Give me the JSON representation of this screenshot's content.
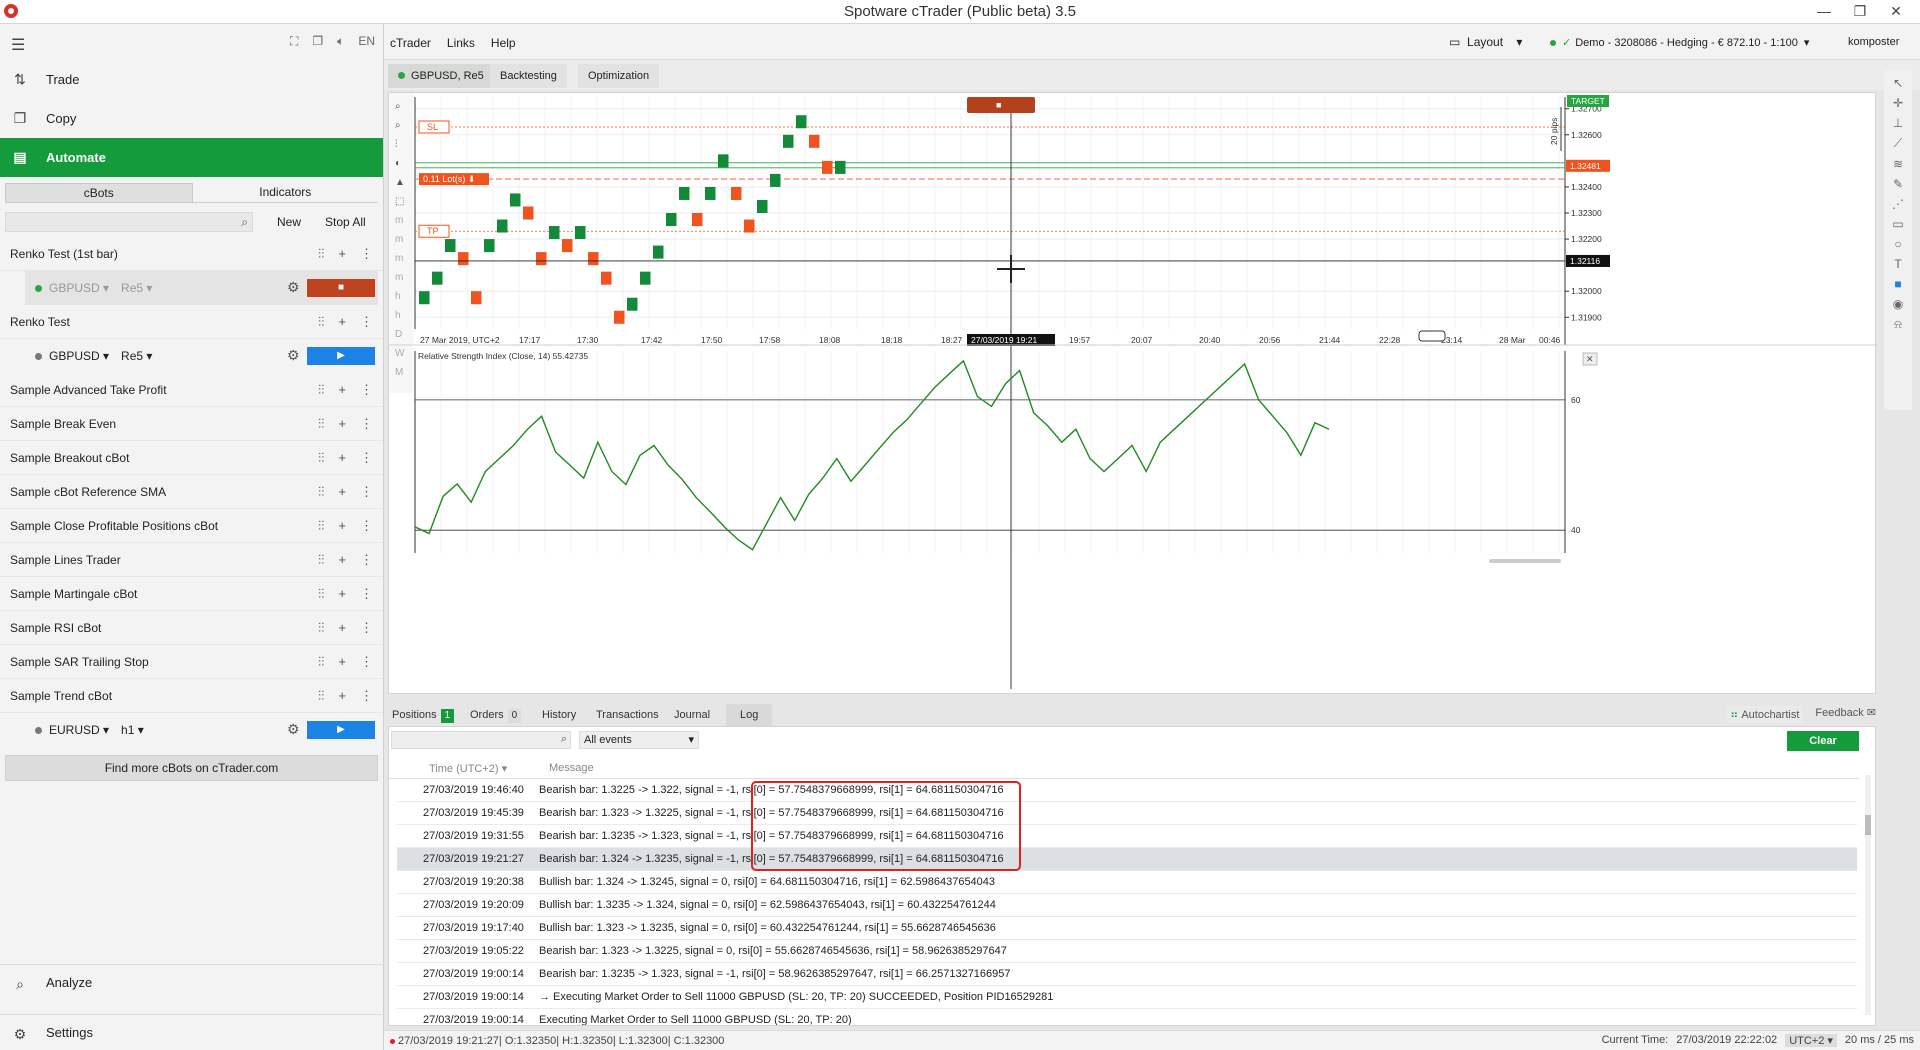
{
  "window": {
    "title": "Spotware cTrader (Public beta) 3.5"
  },
  "nav": {
    "trade": "Trade",
    "copy": "Copy",
    "automate": "Automate",
    "analyze": "Analyze",
    "settings": "Settings",
    "toolbar_lang": "EN"
  },
  "automate": {
    "tabs": [
      "cBots",
      "Indicators"
    ],
    "new_label": "New",
    "stop_all_label": "Stop All",
    "run_glyph": "▶",
    "stop_glyph": "■",
    "bots": [
      {
        "name": "Renko Test (1st bar)",
        "instance": {
          "symbol": "GBPUSD",
          "timeframe": "Re5",
          "running": true
        }
      },
      {
        "name": "Renko Test",
        "instance": {
          "symbol": "GBPUSD",
          "timeframe": "Re5",
          "running": false
        }
      },
      {
        "name": "Sample Advanced Take Profit"
      },
      {
        "name": "Sample Break Even"
      },
      {
        "name": "Sample Breakout cBot"
      },
      {
        "name": "Sample cBot Reference SMA"
      },
      {
        "name": "Sample Close Profitable Positions cBot"
      },
      {
        "name": "Sample Lines Trader"
      },
      {
        "name": "Sample Martingale cBot"
      },
      {
        "name": "Sample RSI cBot"
      },
      {
        "name": "Sample SAR Trailing Stop"
      },
      {
        "name": "Sample Trend cBot",
        "instance": {
          "symbol": "EURUSD",
          "timeframe": "h1",
          "running": false
        }
      }
    ],
    "find_more": "Find more cBots on cTrader.com"
  },
  "menubar": {
    "items": [
      "cTrader",
      "Links",
      "Help"
    ],
    "layout": "Layout",
    "account": "Demo - 3208086 - Hedging - € 872.10 - 1:100",
    "user": "komposter"
  },
  "chart_tabs": [
    "GBPUSD, Re5",
    "Backtesting",
    "Optimization"
  ],
  "chart_data": {
    "type": "line",
    "title": "GBPUSD, Re5",
    "price_axis_ticks": [
      "1.32700",
      "1.32600",
      "1.32400",
      "1.32300",
      "1.32200",
      "1.32000",
      "1.31900"
    ],
    "price_axis_values": [
      1.327,
      1.326,
      1.324,
      1.323,
      1.322,
      1.32,
      1.319
    ],
    "ylim": [
      1.31855,
      1.32745
    ],
    "time_axis_ticks": [
      "27 Mar 2019, UTC+2",
      "17:17",
      "17:30",
      "17:42",
      "17:50",
      "17:58",
      "18:08",
      "18:18",
      "18:27",
      "18:46",
      "19:57",
      "20:07",
      "20:40",
      "20:56",
      "21:44",
      "22:28",
      "23:14",
      "28 Mar",
      "00:46"
    ],
    "crosshair_time": "27/03/2019 19:21",
    "crosshair_price": "1.32116",
    "current_price": "1.32481",
    "target_label": "TARGET",
    "pips_label": "20 pips",
    "sl_label": "SL",
    "tp_label": "TP",
    "position_label": "0.11 Lot(s)",
    "renko_brick_size": 0.0005,
    "renko_bricks": [
      {
        "open": 1.3195,
        "close": 1.32,
        "dir": "up"
      },
      {
        "open": 1.3205,
        "close": 1.3205,
        "dir": "up"
      },
      {
        "open": 1.3215,
        "close": 1.322,
        "dir": "up"
      },
      {
        "open": 1.321,
        "close": 1.3215,
        "dir": "down"
      },
      {
        "open": 1.3195,
        "close": 1.32,
        "dir": "down"
      },
      {
        "open": 1.3215,
        "close": 1.322,
        "dir": "up"
      },
      {
        "open": 1.3225,
        "close": 1.3225,
        "dir": "up"
      },
      {
        "open": 1.323,
        "close": 1.324,
        "dir": "up"
      },
      {
        "open": 1.3235,
        "close": 1.3225,
        "dir": "down"
      },
      {
        "open": 1.3215,
        "close": 1.321,
        "dir": "down"
      },
      {
        "open": 1.322,
        "close": 1.3225,
        "dir": "up"
      },
      {
        "open": 1.322,
        "close": 1.3215,
        "dir": "down"
      },
      {
        "open": 1.322,
        "close": 1.3225,
        "dir": "up"
      },
      {
        "open": 1.3215,
        "close": 1.321,
        "dir": "down"
      },
      {
        "open": 1.3205,
        "close": 1.3205,
        "dir": "down"
      },
      {
        "open": 1.3195,
        "close": 1.3185,
        "dir": "down"
      },
      {
        "open": 1.3195,
        "close": 1.3195,
        "dir": "up"
      },
      {
        "open": 1.3205,
        "close": 1.3205,
        "dir": "up"
      },
      {
        "open": 1.3215,
        "close": 1.3215,
        "dir": "up"
      },
      {
        "open": 1.3225,
        "close": 1.323,
        "dir": "up"
      },
      {
        "open": 1.3235,
        "close": 1.324,
        "dir": "up"
      },
      {
        "open": 1.323,
        "close": 1.3225,
        "dir": "down"
      },
      {
        "open": 1.3235,
        "close": 1.324,
        "dir": "up"
      },
      {
        "open": 1.325,
        "close": 1.325,
        "dir": "up"
      },
      {
        "open": 1.324,
        "close": 1.3235,
        "dir": "down"
      },
      {
        "open": 1.3225,
        "close": 1.3225,
        "dir": "down"
      },
      {
        "open": 1.323,
        "close": 1.3235,
        "dir": "up"
      },
      {
        "open": 1.324,
        "close": 1.3245,
        "dir": "up"
      },
      {
        "open": 1.3255,
        "close": 1.326,
        "dir": "up"
      },
      {
        "open": 1.3265,
        "close": 1.3265,
        "dir": "up"
      },
      {
        "open": 1.326,
        "close": 1.3255,
        "dir": "down"
      },
      {
        "open": 1.325,
        "close": 1.3245,
        "dir": "down"
      },
      {
        "open": 1.3245,
        "close": 1.325,
        "dir": "up"
      }
    ]
  },
  "rsi": {
    "label": "Relative Strength Index (Close, 14) 55.42735",
    "level_60": "60",
    "level_40": "40",
    "values": [
      40.5,
      39.5,
      45.2,
      47.1,
      44.3,
      49.0,
      51.0,
      53.0,
      55.5,
      57.5,
      52.0,
      50.0,
      48.0,
      53.5,
      49.0,
      47.0,
      51.5,
      53.0,
      50.0,
      47.8,
      45.0,
      42.8,
      40.5,
      38.5,
      37.0,
      41.0,
      45.0,
      41.5,
      45.5,
      48.0,
      51.0,
      47.5,
      50.0,
      52.5,
      55.0,
      57.0,
      59.5,
      62.0,
      64.0,
      66.0,
      60.5,
      59.0,
      62.5,
      64.5,
      58.0,
      56.0,
      53.5,
      55.5,
      51.0,
      49.0,
      51.0,
      53.0,
      49.0,
      53.5,
      55.5,
      57.5,
      59.5,
      61.5,
      63.5,
      65.5,
      60.0,
      57.5,
      55.0,
      51.5,
      56.5,
      55.5
    ],
    "ylim": [
      36.5,
      67.5
    ]
  },
  "bottom_tabs": {
    "positions": "Positions",
    "positions_count": "1",
    "orders": "Orders",
    "orders_count": "0",
    "history": "History",
    "transactions": "Transactions",
    "journal": "Journal",
    "log": "Log",
    "autochartist": "Autochartist",
    "feedback": "Feedback"
  },
  "log": {
    "filter_value": "All events",
    "clear_label": "Clear",
    "col_time": "Time (UTC+2)",
    "col_message": "Message",
    "rows": [
      {
        "time": "27/03/2019 19:46:40",
        "message": "Bearish bar: 1.3225 -> 1.322, signal = -1, rsi[0] = 57.7548379668999, rsi[1] = 64.681150304716"
      },
      {
        "time": "27/03/2019 19:45:39",
        "message": "Bearish bar: 1.323 -> 1.3225, signal = -1, rsi[0] = 57.7548379668999, rsi[1] = 64.681150304716"
      },
      {
        "time": "27/03/2019 19:31:55",
        "message": "Bearish bar: 1.3235 -> 1.323, signal = -1, rsi[0] = 57.7548379668999, rsi[1] = 64.681150304716"
      },
      {
        "time": "27/03/2019 19:21:27",
        "message": "Bearish bar: 1.324 -> 1.3235, signal = -1, rsi[0] = 57.7548379668999, rsi[1] = 64.681150304716"
      },
      {
        "time": "27/03/2019 19:20:38",
        "message": "Bullish bar: 1.324 -> 1.3245, signal = 0, rsi[0] = 64.681150304716, rsi[1] = 62.5986437654043"
      },
      {
        "time": "27/03/2019 19:20:09",
        "message": "Bullish bar: 1.3235 -> 1.324, signal = 0, rsi[0] = 62.5986437654043, rsi[1] = 60.432254761244"
      },
      {
        "time": "27/03/2019 19:17:40",
        "message": "Bullish bar: 1.323 -> 1.3235, signal = 0, rsi[0] = 60.432254761244, rsi[1] = 55.6628746545636"
      },
      {
        "time": "27/03/2019 19:05:22",
        "message": "Bearish bar: 1.323 -> 1.3225, signal = 0, rsi[0] = 55.6628746545636, rsi[1] = 58.9626385297647"
      },
      {
        "time": "27/03/2019 19:00:14",
        "message": "Bearish bar: 1.3235 -> 1.323, signal = -1, rsi[0] = 58.9626385297647, rsi[1] = 66.2571327166957"
      },
      {
        "time": "27/03/2019 19:00:14",
        "message": "→ Executing Market Order to Sell 11000 GBPUSD (SL: 20, TP: 20) SUCCEEDED, Position PID16529281"
      },
      {
        "time": "27/03/2019 19:00:14",
        "message": "Executing Market Order to Sell 11000 GBPUSD (SL: 20, TP: 20)"
      }
    ]
  },
  "status": {
    "left": "27/03/2019 19:21:27| O:1.32350| H:1.32350| L:1.32300| C:1.32300",
    "current_time_label": "Current Time:",
    "current_time": "27/03/2019 22:22:02",
    "timezone": "UTC+2",
    "latency": "20 ms / 25 ms"
  },
  "colors": {
    "accent_green": "#149b3b",
    "bull_brick": "#138a3a",
    "bear_brick": "#f0531e",
    "rsi_line": "#1f8a1f",
    "highlight_box": "#d92323"
  }
}
